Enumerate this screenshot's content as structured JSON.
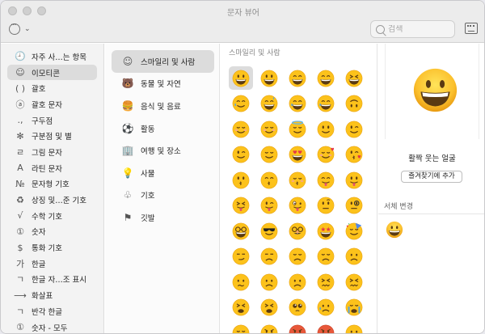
{
  "window": {
    "title": "문자 뷰어"
  },
  "toolbar": {
    "search_placeholder": "검색"
  },
  "sidebar": {
    "items": [
      {
        "icon": "clock-icon",
        "glyph": "🕘",
        "label": "자주 사…는 항목"
      },
      {
        "icon": "smiley-icon",
        "glyph": "☺",
        "label": "이모티콘",
        "active": true
      },
      {
        "icon": "parentheses-icon",
        "glyph": "( )",
        "label": "괄호"
      },
      {
        "icon": "circled-a-icon",
        "glyph": "ⓐ",
        "label": "괄호 문자"
      },
      {
        "icon": "punctuation-icon",
        "glyph": ".,",
        "label": "구두점"
      },
      {
        "icon": "asterisk-icon",
        "glyph": "✻",
        "label": "구분점 및 별"
      },
      {
        "icon": "hangul-letter-icon",
        "glyph": "ㄹ",
        "label": "그림 문자"
      },
      {
        "icon": "latin-a-icon",
        "glyph": "A",
        "label": "라틴 문자"
      },
      {
        "icon": "numero-icon",
        "glyph": "№",
        "label": "문자형 기호"
      },
      {
        "icon": "recycle-icon",
        "glyph": "♻",
        "label": "상징 및…준 기호"
      },
      {
        "icon": "sqrt-icon",
        "glyph": "√",
        "label": "수학 기호"
      },
      {
        "icon": "circled-one-icon",
        "glyph": "①",
        "label": "숫자"
      },
      {
        "icon": "dollar-icon",
        "glyph": "$",
        "label": "통화 기호"
      },
      {
        "icon": "hangul-ga-icon",
        "glyph": "가",
        "label": "한글"
      },
      {
        "icon": "hangul-jamo-icon",
        "glyph": "ㄱ",
        "label": "한글 자…조 표시"
      },
      {
        "icon": "arrow-right-icon",
        "glyph": "⟶",
        "label": "화살표"
      },
      {
        "icon": "halfwidth-hangul-icon",
        "glyph": "ㄱ",
        "label": "반각 한글"
      },
      {
        "icon": "circled-one-icon",
        "glyph": "①",
        "label": "숫자 - 모두"
      }
    ]
  },
  "categories": [
    {
      "icon": "smiley-icon",
      "glyph": "☺",
      "label": "스마일리 및 사람",
      "active": true
    },
    {
      "icon": "bear-icon",
      "glyph": "🐻",
      "label": "동물 및 자연"
    },
    {
      "icon": "food-icon",
      "glyph": "🍔",
      "label": "음식 및 음료"
    },
    {
      "icon": "soccer-ball-icon",
      "glyph": "⚽",
      "label": "활동"
    },
    {
      "icon": "building-icon",
      "glyph": "🏢",
      "label": "여행 및 장소"
    },
    {
      "icon": "lightbulb-icon",
      "glyph": "💡",
      "label": "사물"
    },
    {
      "icon": "symbols-icon",
      "glyph": "♧",
      "label": "기호"
    },
    {
      "icon": "flag-icon",
      "glyph": "⚑",
      "label": "깃발"
    }
  ],
  "grid": {
    "title": "스마일리 및 사람",
    "rows": [
      [
        "grinning",
        "smiley",
        "smile",
        "grin",
        "laughing"
      ],
      [
        "smiling-tear",
        "sweat-smile",
        "joy",
        "rofl",
        "upside-down"
      ],
      [
        "blush",
        "relaxed",
        "innocent",
        "slight-smile",
        "wink"
      ],
      [
        "wink2",
        "relieved",
        "heart-eyes",
        "hearts-face",
        "kissing-heart"
      ],
      [
        "kissing",
        "kissing-smiling",
        "kissing-closed",
        "yum",
        "stuck-out-tongue"
      ],
      [
        "squinting-tongue",
        "winking-tongue",
        "zany",
        "raised-brow",
        "monocle"
      ],
      [
        "nerd",
        "sunglasses",
        "disguise",
        "star-struck",
        "partying"
      ],
      [
        "smirk",
        "unamused",
        "disappointed",
        "pensive",
        "worried"
      ],
      [
        "confused",
        "slight-frown",
        "frowning",
        "persevere",
        "confounded"
      ],
      [
        "tired",
        "weary",
        "pleading",
        "cry",
        "sob"
      ],
      [
        "triumph",
        "angry",
        "rage",
        "cursing",
        "exploding"
      ]
    ]
  },
  "detail": {
    "emoji_name": "활짝 웃는 얼굴",
    "favorite_button": "즐겨찾기에 추가",
    "font_variation_title": "서체 변경"
  }
}
